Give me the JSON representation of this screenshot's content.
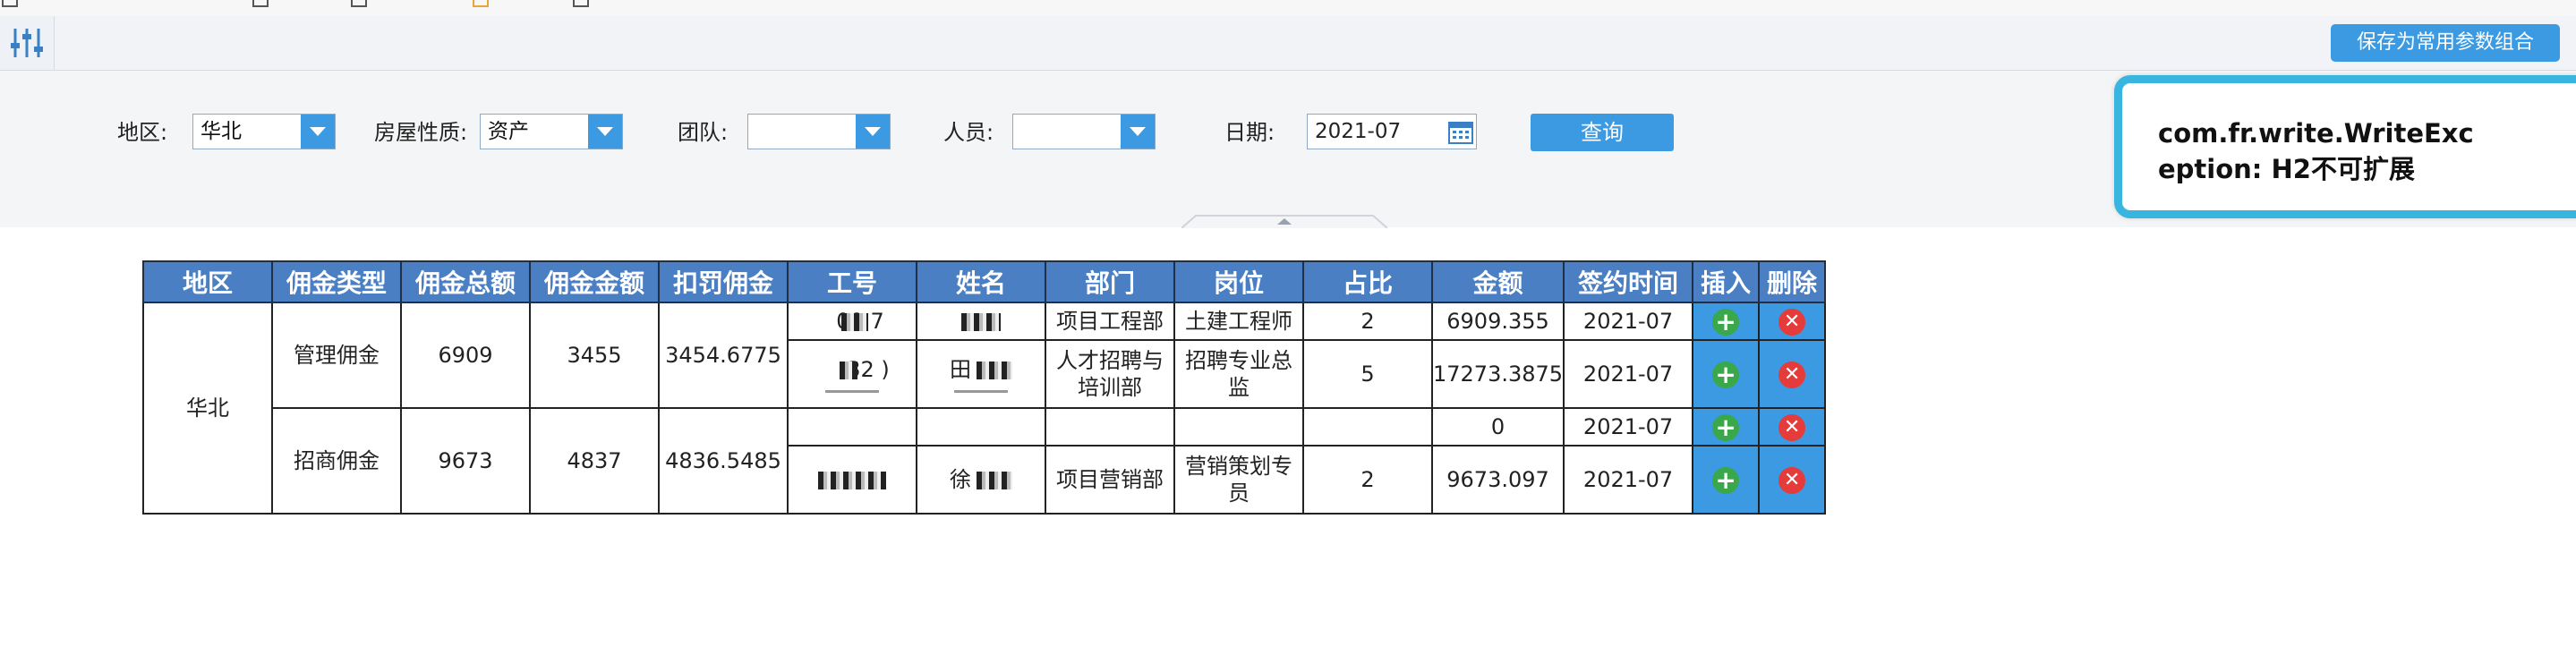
{
  "toolbar": {
    "save_label": "保存为常用参数组合"
  },
  "params": {
    "region_label": "地区:",
    "region_value": "华北",
    "house_label": "房屋性质:",
    "house_value": "资产",
    "team_label": "团队:",
    "team_value": "",
    "staff_label": "人员:",
    "staff_value": "",
    "date_label": "日期:",
    "date_value": "2021-07",
    "query_label": "查询"
  },
  "error": {
    "message": "com.fr.write.WriteException: H2不可扩展"
  },
  "table": {
    "headers": [
      "地区",
      "佣金类型",
      "佣金总额",
      "佣金金额",
      "扣罚佣金",
      "工号",
      "姓名",
      "部门",
      "岗位",
      "占比",
      "金额",
      "签约时间",
      "插入",
      "删除"
    ],
    "region": "华北",
    "groups": [
      {
        "type": "管理佣金",
        "total": "6909",
        "amount": "3455",
        "penalty": "3454.6775",
        "rows": [
          {
            "emp_id": "00  7",
            "name": "",
            "dept": "项目工程部",
            "post": "土建工程师",
            "ratio": "2",
            "money": "6909.355",
            "date": "2021-07"
          },
          {
            "emp_id": "32  )",
            "name": "田",
            "dept": "人才招聘与培训部",
            "post": "招聘专业总监",
            "ratio": "5",
            "money": "17273.3875",
            "date": "2021-07"
          }
        ]
      },
      {
        "type": "招商佣金",
        "total": "9673",
        "amount": "4837",
        "penalty": "4836.5485",
        "rows": [
          {
            "emp_id": "",
            "name": "",
            "dept": "",
            "post": "",
            "ratio": "",
            "money": "0",
            "date": "2021-07"
          },
          {
            "emp_id": "",
            "name": "徐",
            "dept": "项目营销部",
            "post": "营销策划专员",
            "ratio": "2",
            "money": "9673.097",
            "date": "2021-07"
          }
        ]
      }
    ]
  },
  "icons": {
    "settings": "sliders-icon",
    "calendar": "calendar-icon",
    "insert": "plus-icon",
    "delete": "close-icon"
  },
  "colors": {
    "accent": "#3b9ae1",
    "header_bg": "#4a7fc4",
    "tooltip_border": "#39b6e0",
    "insert": "#3aa84a",
    "delete": "#e53b3b"
  }
}
